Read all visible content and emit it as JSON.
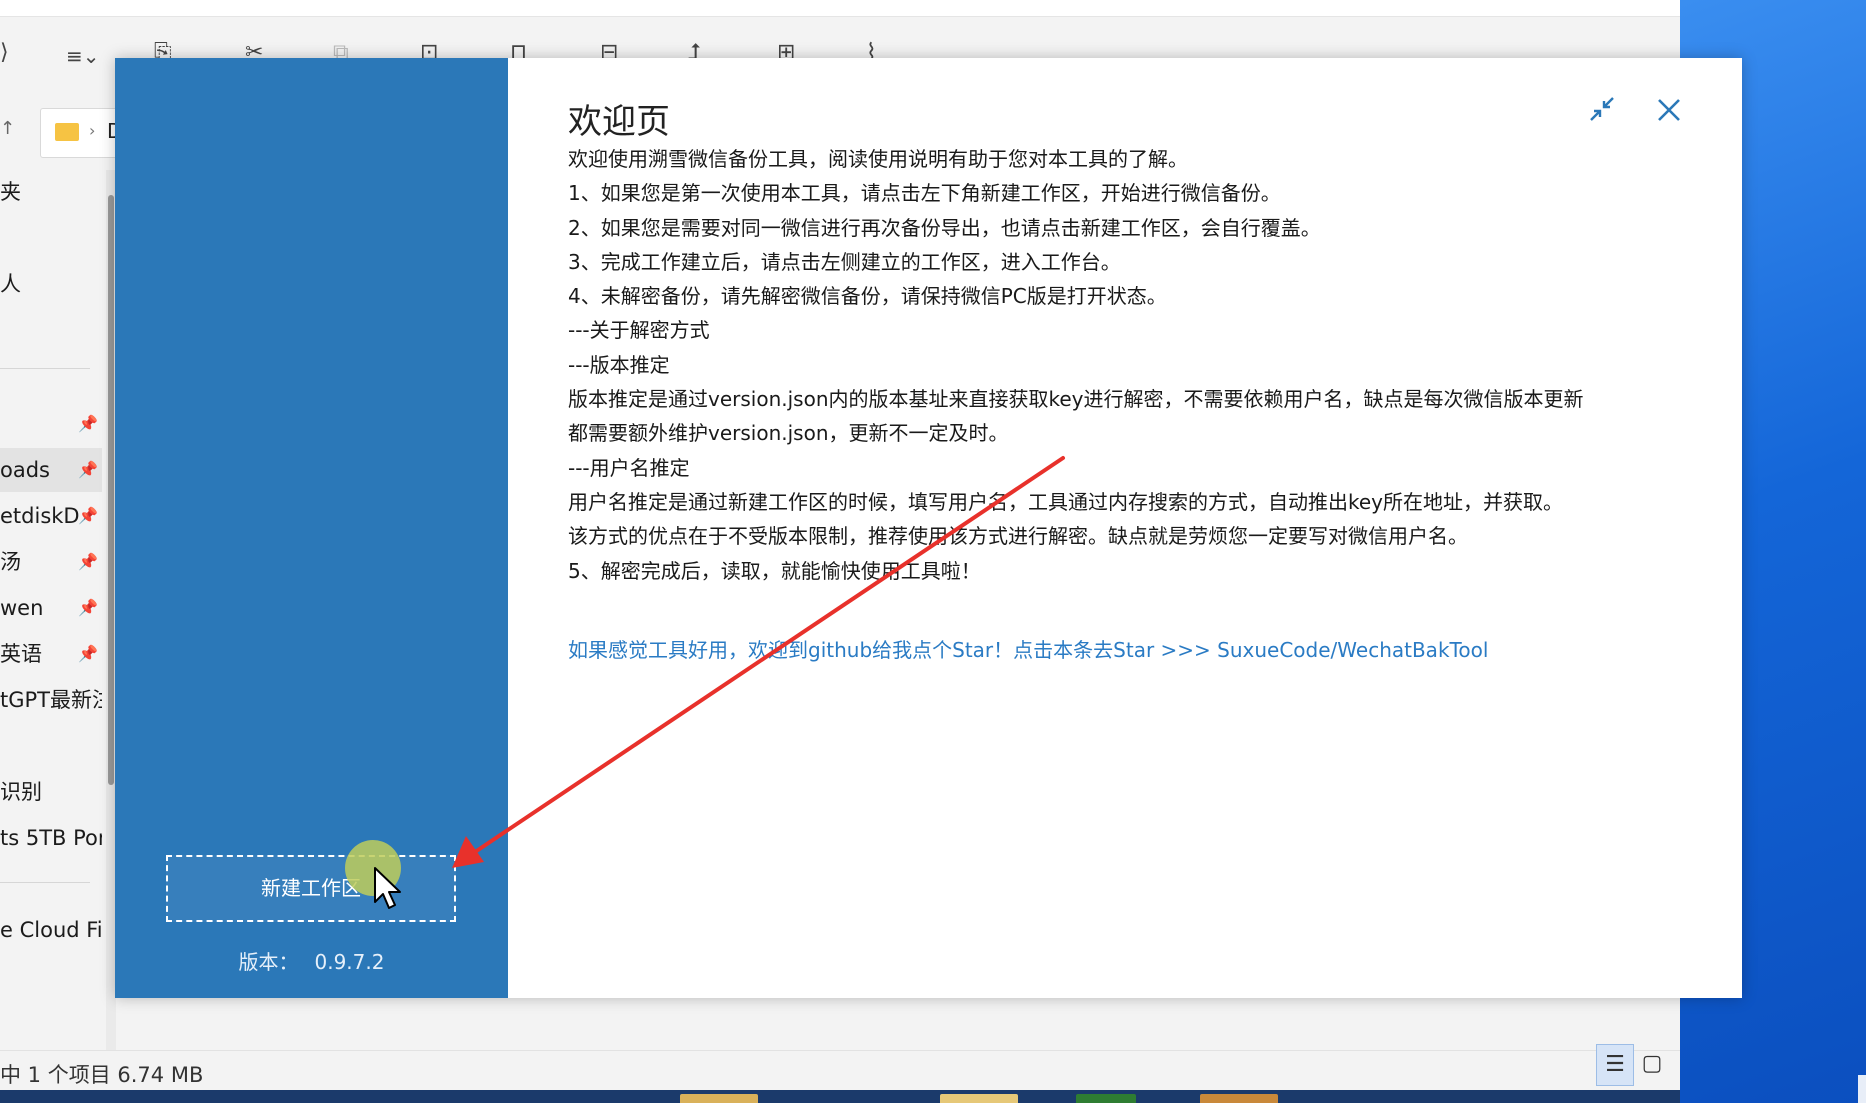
{
  "explorer": {
    "address_fragment": "D",
    "nav_items": [
      {
        "label": "夹",
        "pinned": false
      },
      {
        "label": "人",
        "pinned": false
      },
      {
        "label": "",
        "pinned": true
      },
      {
        "label": "oads",
        "pinned": true,
        "selected": true
      },
      {
        "label": "etdiskD",
        "pinned": true
      },
      {
        "label": "汤",
        "pinned": true
      },
      {
        "label": "wen",
        "pinned": true
      },
      {
        "label": "英语",
        "pinned": true
      },
      {
        "label": "tGPT最新注",
        "pinned": false
      },
      {
        "label": "识别",
        "pinned": false
      },
      {
        "label": "ts 5TB Por",
        "pinned": false
      },
      {
        "label": "e Cloud Fil",
        "pinned": false
      }
    ],
    "status_text": "中 1 个项目  6.74 MB"
  },
  "dialog": {
    "title": "欢迎页",
    "lines": [
      "欢迎使用溯雪微信备份工具，阅读使用说明有助于您对本工具的了解。",
      "1、如果您是第一次使用本工具，请点击左下角新建工作区，开始进行微信备份。",
      "2、如果您是需要对同一微信进行再次备份导出，也请点击新建工作区，会自行覆盖。",
      "3、完成工作建立后，请点击左侧建立的工作区，进入工作台。",
      "4、未解密备份，请先解密微信备份，请保持微信PC版是打开状态。",
      "---关于解密方式",
      "---版本推定",
      "版本推定是通过version.json内的版本基址来直接获取key进行解密，不需要依赖用户名，缺点是每次微信版本更新",
      "都需要额外维护version.json，更新不一定及时。",
      "---用户名推定",
      "用户名推定是通过新建工作区的时候，填写用户名，工具通过内存搜索的方式，自动推出key所在地址，并获取。",
      "该方式的优点在于不受版本限制，推荐使用该方式进行解密。缺点就是劳烦您一定要写对微信用户名。",
      "5、解密完成后，读取，就能愉快使用工具啦！"
    ],
    "github_link": "如果感觉工具好用，欢迎到github给我点个Star！点击本条去Star  >>>  SuxueCode/WechatBakTool",
    "new_workspace_label": "新建工作区",
    "version_label": "版本：",
    "version_value": "0.9.7.2"
  },
  "colors": {
    "sidebar": "#2b78b8",
    "link": "#2a7bc4",
    "annotation_arrow": "#e8312b",
    "click_highlight": "#bccd5a"
  },
  "icons": [
    "restore-icon",
    "close-icon",
    "mouse-cursor-icon",
    "pin-icon",
    "folder-icon",
    "details-view-icon",
    "tiles-view-icon"
  ]
}
